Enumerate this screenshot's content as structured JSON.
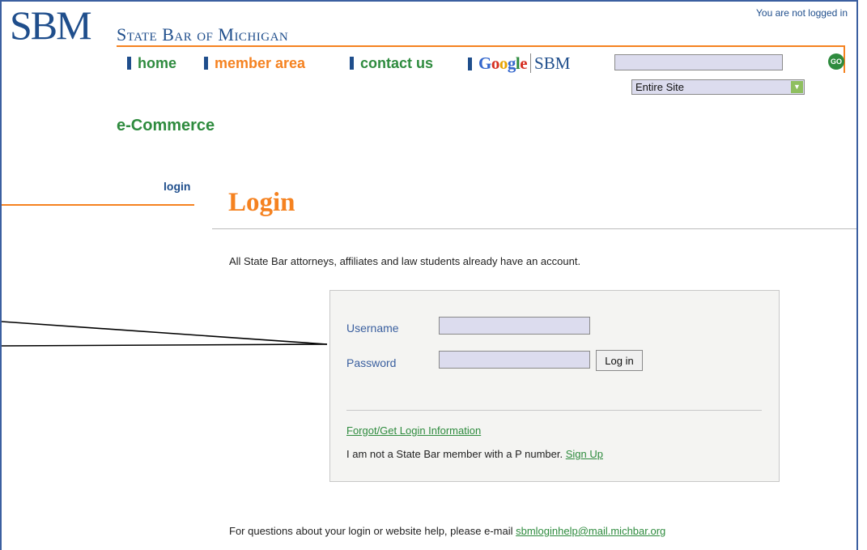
{
  "header": {
    "logo_text": "SBM",
    "site_title": "State Bar of Michigan",
    "login_status": "You are not logged in"
  },
  "nav": {
    "items": [
      {
        "label": "home"
      },
      {
        "label": "member area"
      },
      {
        "label": "contact us"
      }
    ],
    "google_word": "Google",
    "google_suffix": "SBM"
  },
  "search": {
    "value": "",
    "go_label": "GO",
    "scope_selected": "Entire Site"
  },
  "section": {
    "title": "e-Commerce",
    "sidebar_link": "login"
  },
  "page": {
    "title": "Login",
    "intro": "All State Bar attorneys, affiliates and law students already have an account."
  },
  "login_form": {
    "username_label": "Username",
    "username_value": "",
    "password_label": "Password",
    "password_value": "",
    "submit_label": "Log in",
    "forgot_link": "Forgot/Get Login Information",
    "not_member_text": "I am not a State Bar member with a P number.",
    "signup_link": "Sign Up"
  },
  "footer": {
    "help_text": "For questions about your login or website help, please e-mail",
    "help_email": "sbmloginhelp@mail.michbar.org"
  },
  "colors": {
    "brand_blue": "#1f4e8c",
    "brand_green": "#2e8b3e",
    "accent_orange": "#f58220",
    "input_bg": "#dcdcee"
  }
}
